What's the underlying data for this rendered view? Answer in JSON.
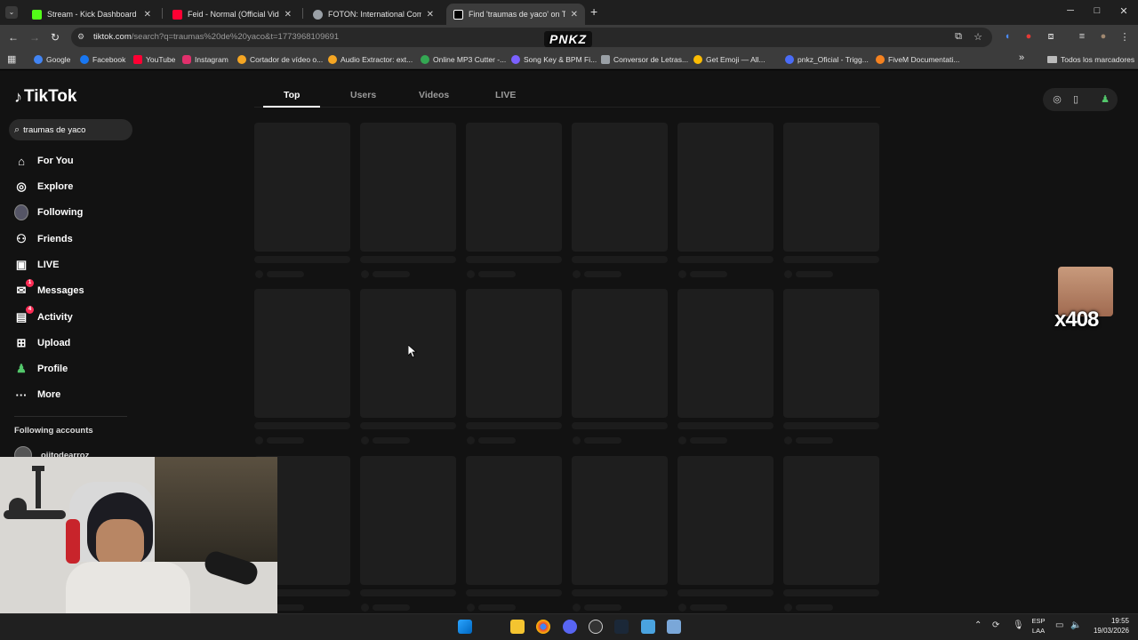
{
  "browser": {
    "tabs": [
      {
        "title": "Stream - Kick Dashboard",
        "favicon_color": "#53fc18",
        "active": false
      },
      {
        "title": "Feid - Normal (Official Video) -",
        "favicon_color": "#ff0033",
        "active": false
      },
      {
        "title": "FOTON: International Commerc",
        "favicon_color": "#9aa0a6",
        "active": false
      },
      {
        "title": "Find 'traumas de yaco' on TikTo",
        "favicon_color": "#ffffff",
        "active": true
      }
    ],
    "new_tab": "+",
    "window_controls": {
      "minimize": "─",
      "maximize": "□",
      "close": "✕"
    },
    "url_host": "tiktok.com",
    "url_rest": "/search?q=traumas%20de%20yaco&t=1773968109691",
    "overlay_logo": "PNKZ",
    "bookmarks": [
      {
        "label": "Google",
        "color": "#4285f4"
      },
      {
        "label": "Facebook",
        "color": "#1877f2"
      },
      {
        "label": "YouTube",
        "color": "#ff0033"
      },
      {
        "label": "Instagram",
        "color": "#e1306c"
      },
      {
        "label": "Cortador de vídeo o...",
        "color": "#f5a623"
      },
      {
        "label": "Audio Extractor: ext...",
        "color": "#f5a623"
      },
      {
        "label": "Online MP3 Cutter -...",
        "color": "#34a853"
      },
      {
        "label": "Song Key & BPM Fi...",
        "color": "#7b61ff"
      },
      {
        "label": "Conversor de Letras...",
        "color": "#9aa0a6"
      },
      {
        "label": "Get Emoji — All...",
        "color": "#fbbc04"
      },
      {
        "label": "pnkz_Oficial - Trigg...",
        "color": "#4a6cf7"
      },
      {
        "label": "FiveM Documentati...",
        "color": "#f58220"
      }
    ],
    "bookmarks_more": "»",
    "all_bookmarks": "Todos los marcadores"
  },
  "tiktok": {
    "logo": "TikTok",
    "search_value": "traumas de yaco",
    "nav": [
      {
        "label": "For You",
        "icon": "home-icon",
        "glyph": "⌂",
        "badge": ""
      },
      {
        "label": "Explore",
        "icon": "compass-icon",
        "glyph": "◎",
        "badge": ""
      },
      {
        "label": "Following",
        "icon": "avatar-icon",
        "glyph": "●",
        "badge": ""
      },
      {
        "label": "Friends",
        "icon": "friends-icon",
        "glyph": "⚇",
        "badge": ""
      },
      {
        "label": "LIVE",
        "icon": "live-icon",
        "glyph": "▣",
        "badge": ""
      },
      {
        "label": "Messages",
        "icon": "messages-icon",
        "glyph": "✉",
        "badge": "1"
      },
      {
        "label": "Activity",
        "icon": "activity-icon",
        "glyph": "▤",
        "badge": "4"
      },
      {
        "label": "Upload",
        "icon": "upload-icon",
        "glyph": "⊞",
        "badge": ""
      },
      {
        "label": "Profile",
        "icon": "profile-icon",
        "glyph": "♟",
        "badge": ""
      },
      {
        "label": "More",
        "icon": "more-icon",
        "glyph": "···",
        "badge": ""
      }
    ],
    "following_accounts_heading": "Following accounts",
    "following_account": "ojitodearroz",
    "search_tabs": [
      "Top",
      "Users",
      "Videos",
      "LIVE"
    ],
    "active_search_tab": "Top"
  },
  "overlay": {
    "counter": "x408"
  },
  "taskbar": {
    "lang_top": "ESP",
    "lang_bottom": "LAA",
    "time": "19:55",
    "date": "19/03/2026"
  }
}
